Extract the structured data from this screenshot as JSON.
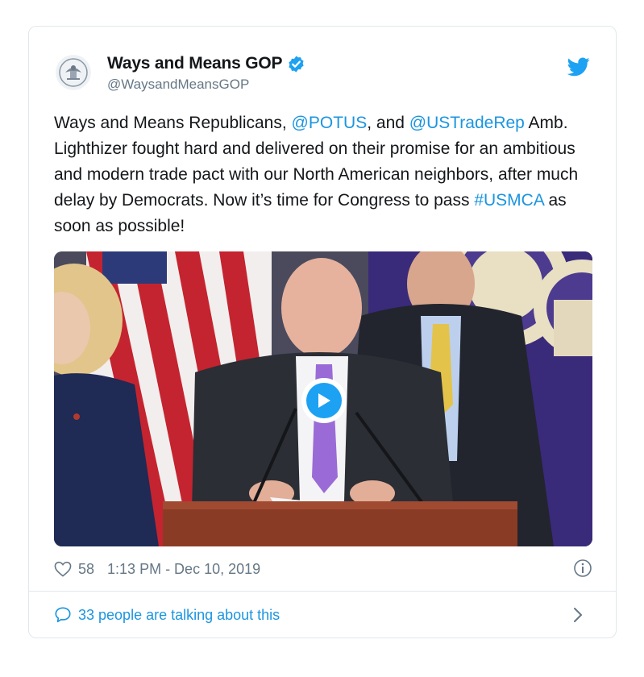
{
  "account": {
    "display_name": "Ways and Means GOP",
    "handle": "@WaysandMeansGOP",
    "verified": true
  },
  "tweet": {
    "text_parts": {
      "p1": "Ways and Means Republicans, ",
      "m1": "@POTUS",
      "p2": ", and ",
      "m2": "@USTradeRep",
      "p3": " Amb. Lighthizer fought hard and delivered on their promise for an ambitious and modern trade pact with our North American neighbors, after much delay by Democrats. Now it’s time for Congress to pass ",
      "h1": "#USMCA",
      "p4": " as soon as possible!"
    }
  },
  "media": {
    "type": "video",
    "play_icon": "play-icon"
  },
  "meta": {
    "likes": "58",
    "timestamp": "1:13 PM - Dec 10, 2019"
  },
  "conversation": {
    "label": "33 people are talking about this"
  },
  "icons": {
    "brand": "twitter-bird-icon",
    "verified": "verified-badge-icon",
    "like": "heart-icon",
    "info": "info-icon",
    "reply": "speech-bubble-icon",
    "chevron": "chevron-right-icon"
  },
  "colors": {
    "link": "#1b95e0",
    "brand": "#1da1f2",
    "muted": "#657786",
    "border": "#e1e8ed"
  }
}
